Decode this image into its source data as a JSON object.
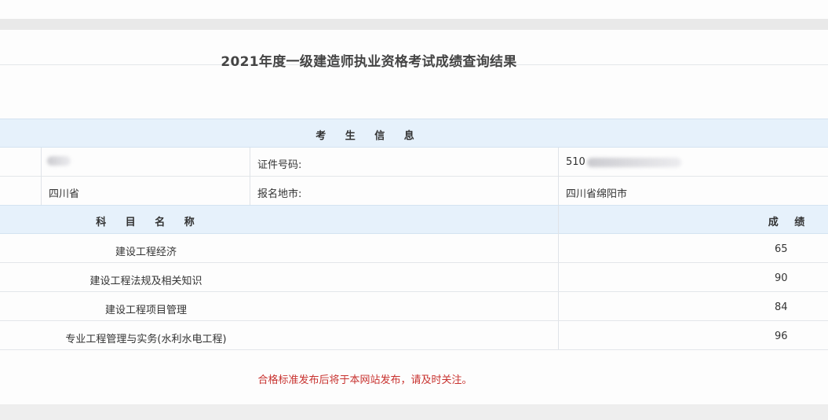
{
  "page": {
    "title": "2021年度一级建造师执业资格考试成绩查询结果"
  },
  "candidate_section": {
    "heading": "考 生 信 息",
    "name_value": "",
    "id_label": "证件号码:",
    "id_value": "510",
    "province_value": "四川省",
    "city_label": "报名地市:",
    "city_value": "四川省绵阳市"
  },
  "scores_section": {
    "subject_header": "科 目 名 称",
    "score_header": "成 绩",
    "rows": [
      {
        "subject": "建设工程经济",
        "score": "65"
      },
      {
        "subject": "建设工程法规及相关知识",
        "score": "90"
      },
      {
        "subject": "建设工程项目管理",
        "score": "84"
      },
      {
        "subject": "专业工程管理与实务(水利水电工程)",
        "score": "96"
      }
    ]
  },
  "notice": "合格标准发布后将于本网站发布，请及时关注。"
}
